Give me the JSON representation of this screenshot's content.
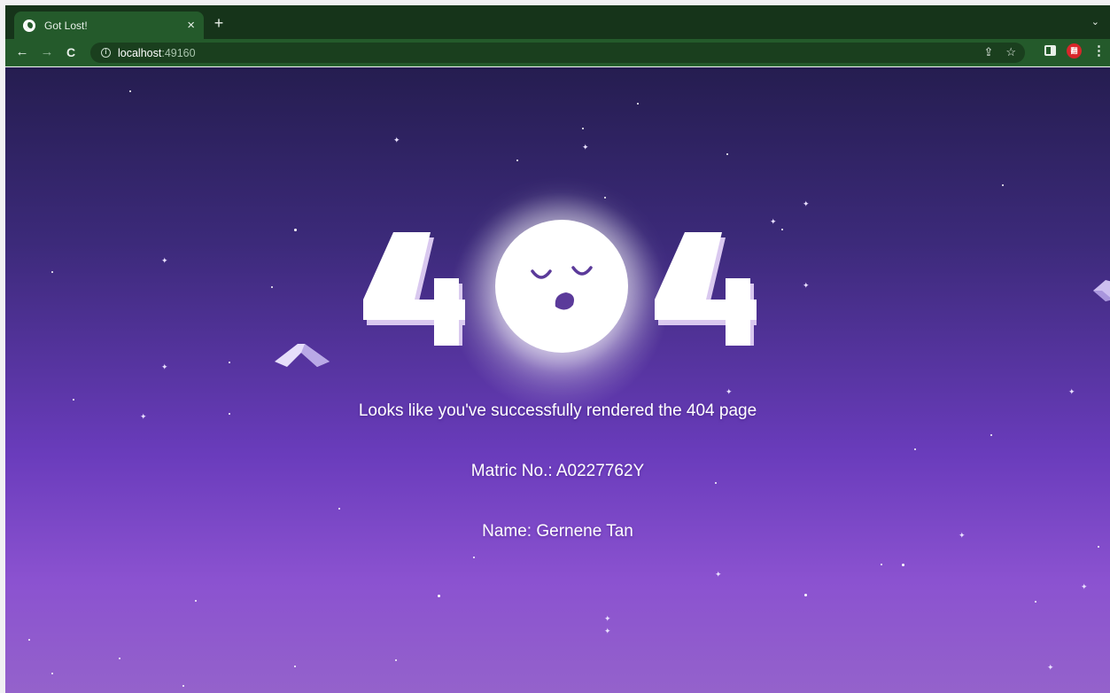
{
  "browser": {
    "tab": {
      "title": "Got Lost!",
      "favicon": "globe-icon",
      "close_glyph": "×"
    },
    "new_tab_glyph": "+",
    "tab_menu_glyph": "⌄",
    "nav": {
      "back": "←",
      "forward": "→",
      "reload": "C"
    },
    "omnibox": {
      "host": "localhost",
      "port": ":49160",
      "info_glyph": "i"
    },
    "actions": {
      "share": "⇪",
      "bookmark": "☆",
      "more": "⋮",
      "extension_label": "翻"
    }
  },
  "page": {
    "digit_left": "4",
    "digit_right": "4",
    "message": "Looks like you've successfully rendered the 404 page",
    "matric": "Matric No.: A0227762Y",
    "name": "Name: Gernene Tan"
  },
  "colors": {
    "tabstrip": "#16341a",
    "toolbar": "#245a2b",
    "sky_top": "#251d50",
    "sky_bottom": "#9462cb",
    "moon_mouth": "#5b3a9a"
  }
}
